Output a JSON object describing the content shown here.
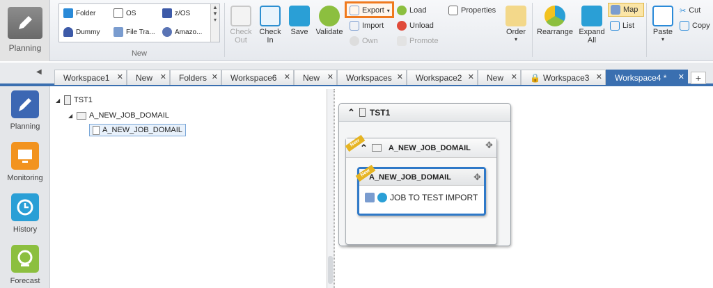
{
  "sidebar_top": {
    "planning_label": "Planning"
  },
  "new_group": {
    "label": "New",
    "items": [
      "Folder",
      "OS",
      "z/OS",
      "Dummy",
      "File Tra...",
      "Amazo..."
    ]
  },
  "toolbar": {
    "check_out": "Check\nOut",
    "check_in": "Check\nIn",
    "save": "Save",
    "validate": "Validate",
    "export": "Export",
    "import": "Import",
    "own": "Own",
    "load": "Load",
    "unload": "Unload",
    "promote": "Promote",
    "properties": "Properties",
    "order": "Order",
    "rearrange": "Rearrange",
    "expand_all": "Expand\nAll",
    "map": "Map",
    "list": "List",
    "paste": "Paste",
    "cut": "Cut",
    "copy": "Copy"
  },
  "tabs": [
    {
      "label": "Workspace1",
      "active": false
    },
    {
      "label": "New",
      "active": false
    },
    {
      "label": "Folders",
      "active": false
    },
    {
      "label": "Workspace6",
      "active": false
    },
    {
      "label": "New",
      "active": false
    },
    {
      "label": "Workspaces",
      "active": false
    },
    {
      "label": "Workspace2",
      "active": false
    },
    {
      "label": "New",
      "active": false
    },
    {
      "label": "Workspace3",
      "active": false,
      "locked": true
    },
    {
      "label": "Workspace4 *",
      "active": true
    }
  ],
  "nav": [
    {
      "label": "Planning",
      "icon": "pencil-icon",
      "color": "#3c67b3"
    },
    {
      "label": "Monitoring",
      "icon": "monitor-icon",
      "color": "#f2931f"
    },
    {
      "label": "History",
      "icon": "history-icon",
      "color": "#2a9fd6"
    },
    {
      "label": "Forecast",
      "icon": "forecast-icon",
      "color": "#8cbf3f"
    }
  ],
  "tree": {
    "root": "TST1",
    "folder": "A_NEW_JOB_DOMAIL",
    "job": "A_NEW_JOB_DOMAIL"
  },
  "canvas": {
    "server": "TST1",
    "folder": "A_NEW_JOB_DOMAIL",
    "subfolder": "A_NEW_JOB_DOMAIL",
    "job": "JOB TO TEST IMPORT",
    "new_badge": "New"
  },
  "colors": {
    "accent": "#3a6fb0",
    "highlight": "#f07a1e"
  }
}
